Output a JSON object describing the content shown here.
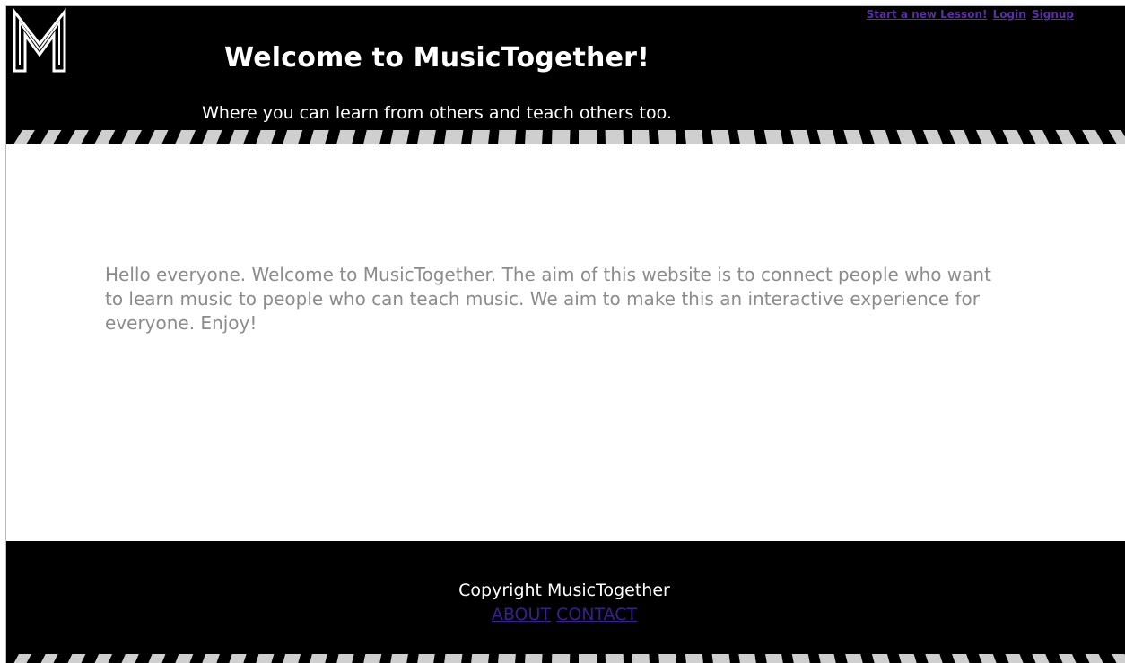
{
  "header": {
    "title": "Welcome to MusicTogether!",
    "subtitle": "Where you can learn from others and teach others too."
  },
  "nav": {
    "links": [
      "Start a new Lesson!",
      "Login",
      "Signup"
    ]
  },
  "main": {
    "intro": "Hello everyone. Welcome to MusicTogether. The aim of this website is to connect people who want to learn music to people who can teach music. We aim to make this an interactive experience for everyone. Enjoy!"
  },
  "footer": {
    "copyright": "Copyright MusicTogether",
    "links": [
      "ABOUT",
      "CONTACT"
    ]
  },
  "icons": {
    "logo": "m-logo-icon",
    "keys": "piano-keys-icon"
  },
  "colors": {
    "background": "#000000",
    "link": "#5a2ea6",
    "footer_link": "#3a1f8f",
    "intro_text": "#8c8c8c"
  }
}
